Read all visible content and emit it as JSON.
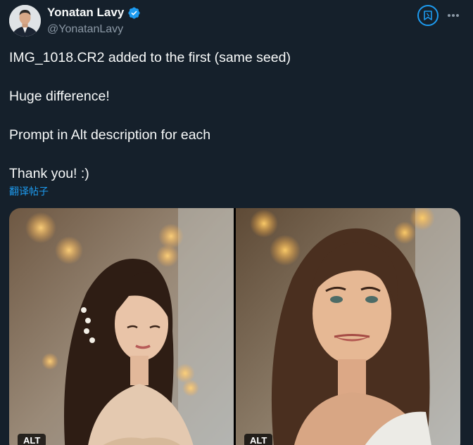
{
  "author": {
    "display_name": "Yonatan Lavy",
    "handle": "@YonatanLavy",
    "verified_icon": "verified-badge-icon"
  },
  "actions": {
    "grok_icon": "grok-icon",
    "more_icon": "more-options-icon"
  },
  "tweet": {
    "paragraphs": [
      "IMG_1018.CR2 added to the first (same seed)",
      "Huge difference!",
      "Prompt in Alt description for each",
      "Thank you! :)"
    ],
    "translate_label": "翻译帖子"
  },
  "media": {
    "photos": [
      {
        "alt_label": "ALT"
      },
      {
        "alt_label": "ALT"
      }
    ]
  },
  "colors": {
    "background": "#15202b",
    "accent": "#1d9bf0",
    "text": "#f7f9f9",
    "secondary_text": "#8b98a5"
  }
}
